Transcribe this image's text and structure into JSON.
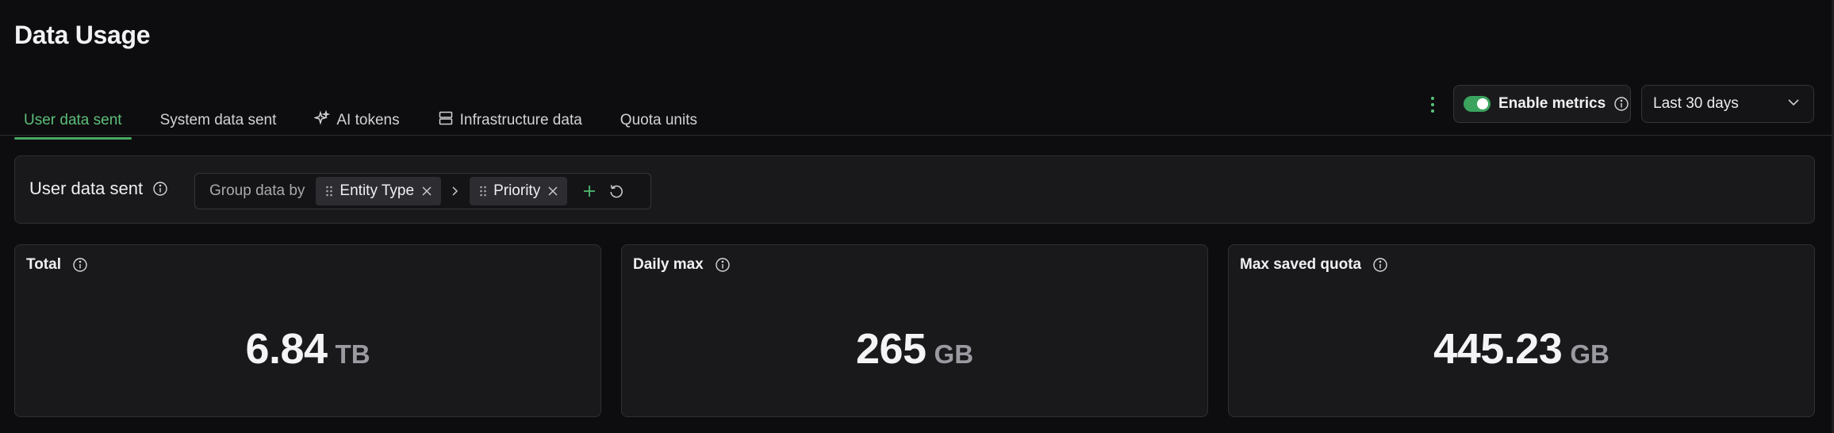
{
  "page": {
    "title": "Data Usage"
  },
  "tabs": [
    {
      "label": "User data sent",
      "icon": "",
      "active": true
    },
    {
      "label": "System data sent",
      "icon": "",
      "active": false
    },
    {
      "label": "AI tokens",
      "icon": "sparkle-icon",
      "active": false
    },
    {
      "label": "Infrastructure data",
      "icon": "server-icon",
      "active": false
    },
    {
      "label": "Quota units",
      "icon": "",
      "active": false
    }
  ],
  "toolbar": {
    "enable_metrics_label": "Enable metrics",
    "enable_metrics_on": true,
    "date_range": "Last 30 days"
  },
  "group_panel": {
    "title": "User data sent",
    "group_label": "Group data by",
    "chips": [
      "Entity Type",
      "Priority"
    ]
  },
  "cards": [
    {
      "title": "Total",
      "value": "6.84",
      "unit": "TB"
    },
    {
      "title": "Daily max",
      "value": "265",
      "unit": "GB"
    },
    {
      "title": "Max saved quota",
      "value": "445.23",
      "unit": "GB"
    }
  ],
  "colors": {
    "accent": "#46a863",
    "background": "#0d0c0e",
    "panel": "#19191c"
  }
}
